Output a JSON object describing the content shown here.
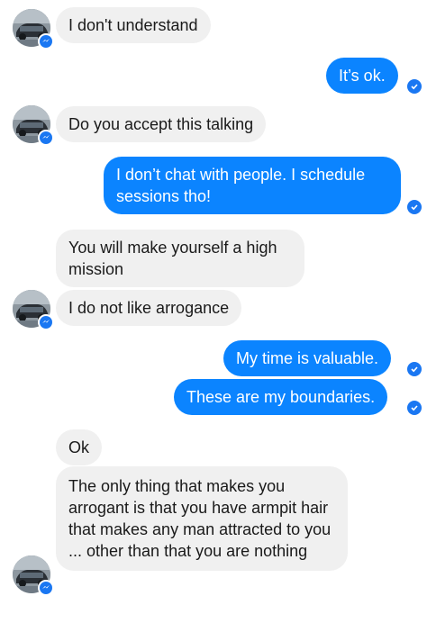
{
  "contact": {
    "avatar_icon": "contact-avatar-car-photo",
    "badge_icon": "messenger-icon"
  },
  "colors": {
    "outgoing_bubble": "#0b84ff",
    "incoming_bubble": "#f0f0f0",
    "read_receipt": "#1a77f2"
  },
  "messages": [
    {
      "direction": "incoming",
      "text": "I don't understand"
    },
    {
      "direction": "outgoing",
      "text": "It’s ok."
    },
    {
      "direction": "incoming",
      "text": "Do you accept this talking"
    },
    {
      "direction": "outgoing",
      "text": "I don’t chat with people. I schedule sessions tho!"
    },
    {
      "direction": "incoming",
      "text": "You will make yourself a high mission"
    },
    {
      "direction": "incoming",
      "text": "I do not like arrogance"
    },
    {
      "direction": "outgoing",
      "text": "My time is valuable."
    },
    {
      "direction": "outgoing",
      "text": "These are my boundaries."
    },
    {
      "direction": "incoming",
      "text": "Ok"
    },
    {
      "direction": "incoming",
      "text": "The only thing that makes you arrogant is that you have armpit hair that makes any man attracted to you ... other than that you are nothing"
    }
  ]
}
